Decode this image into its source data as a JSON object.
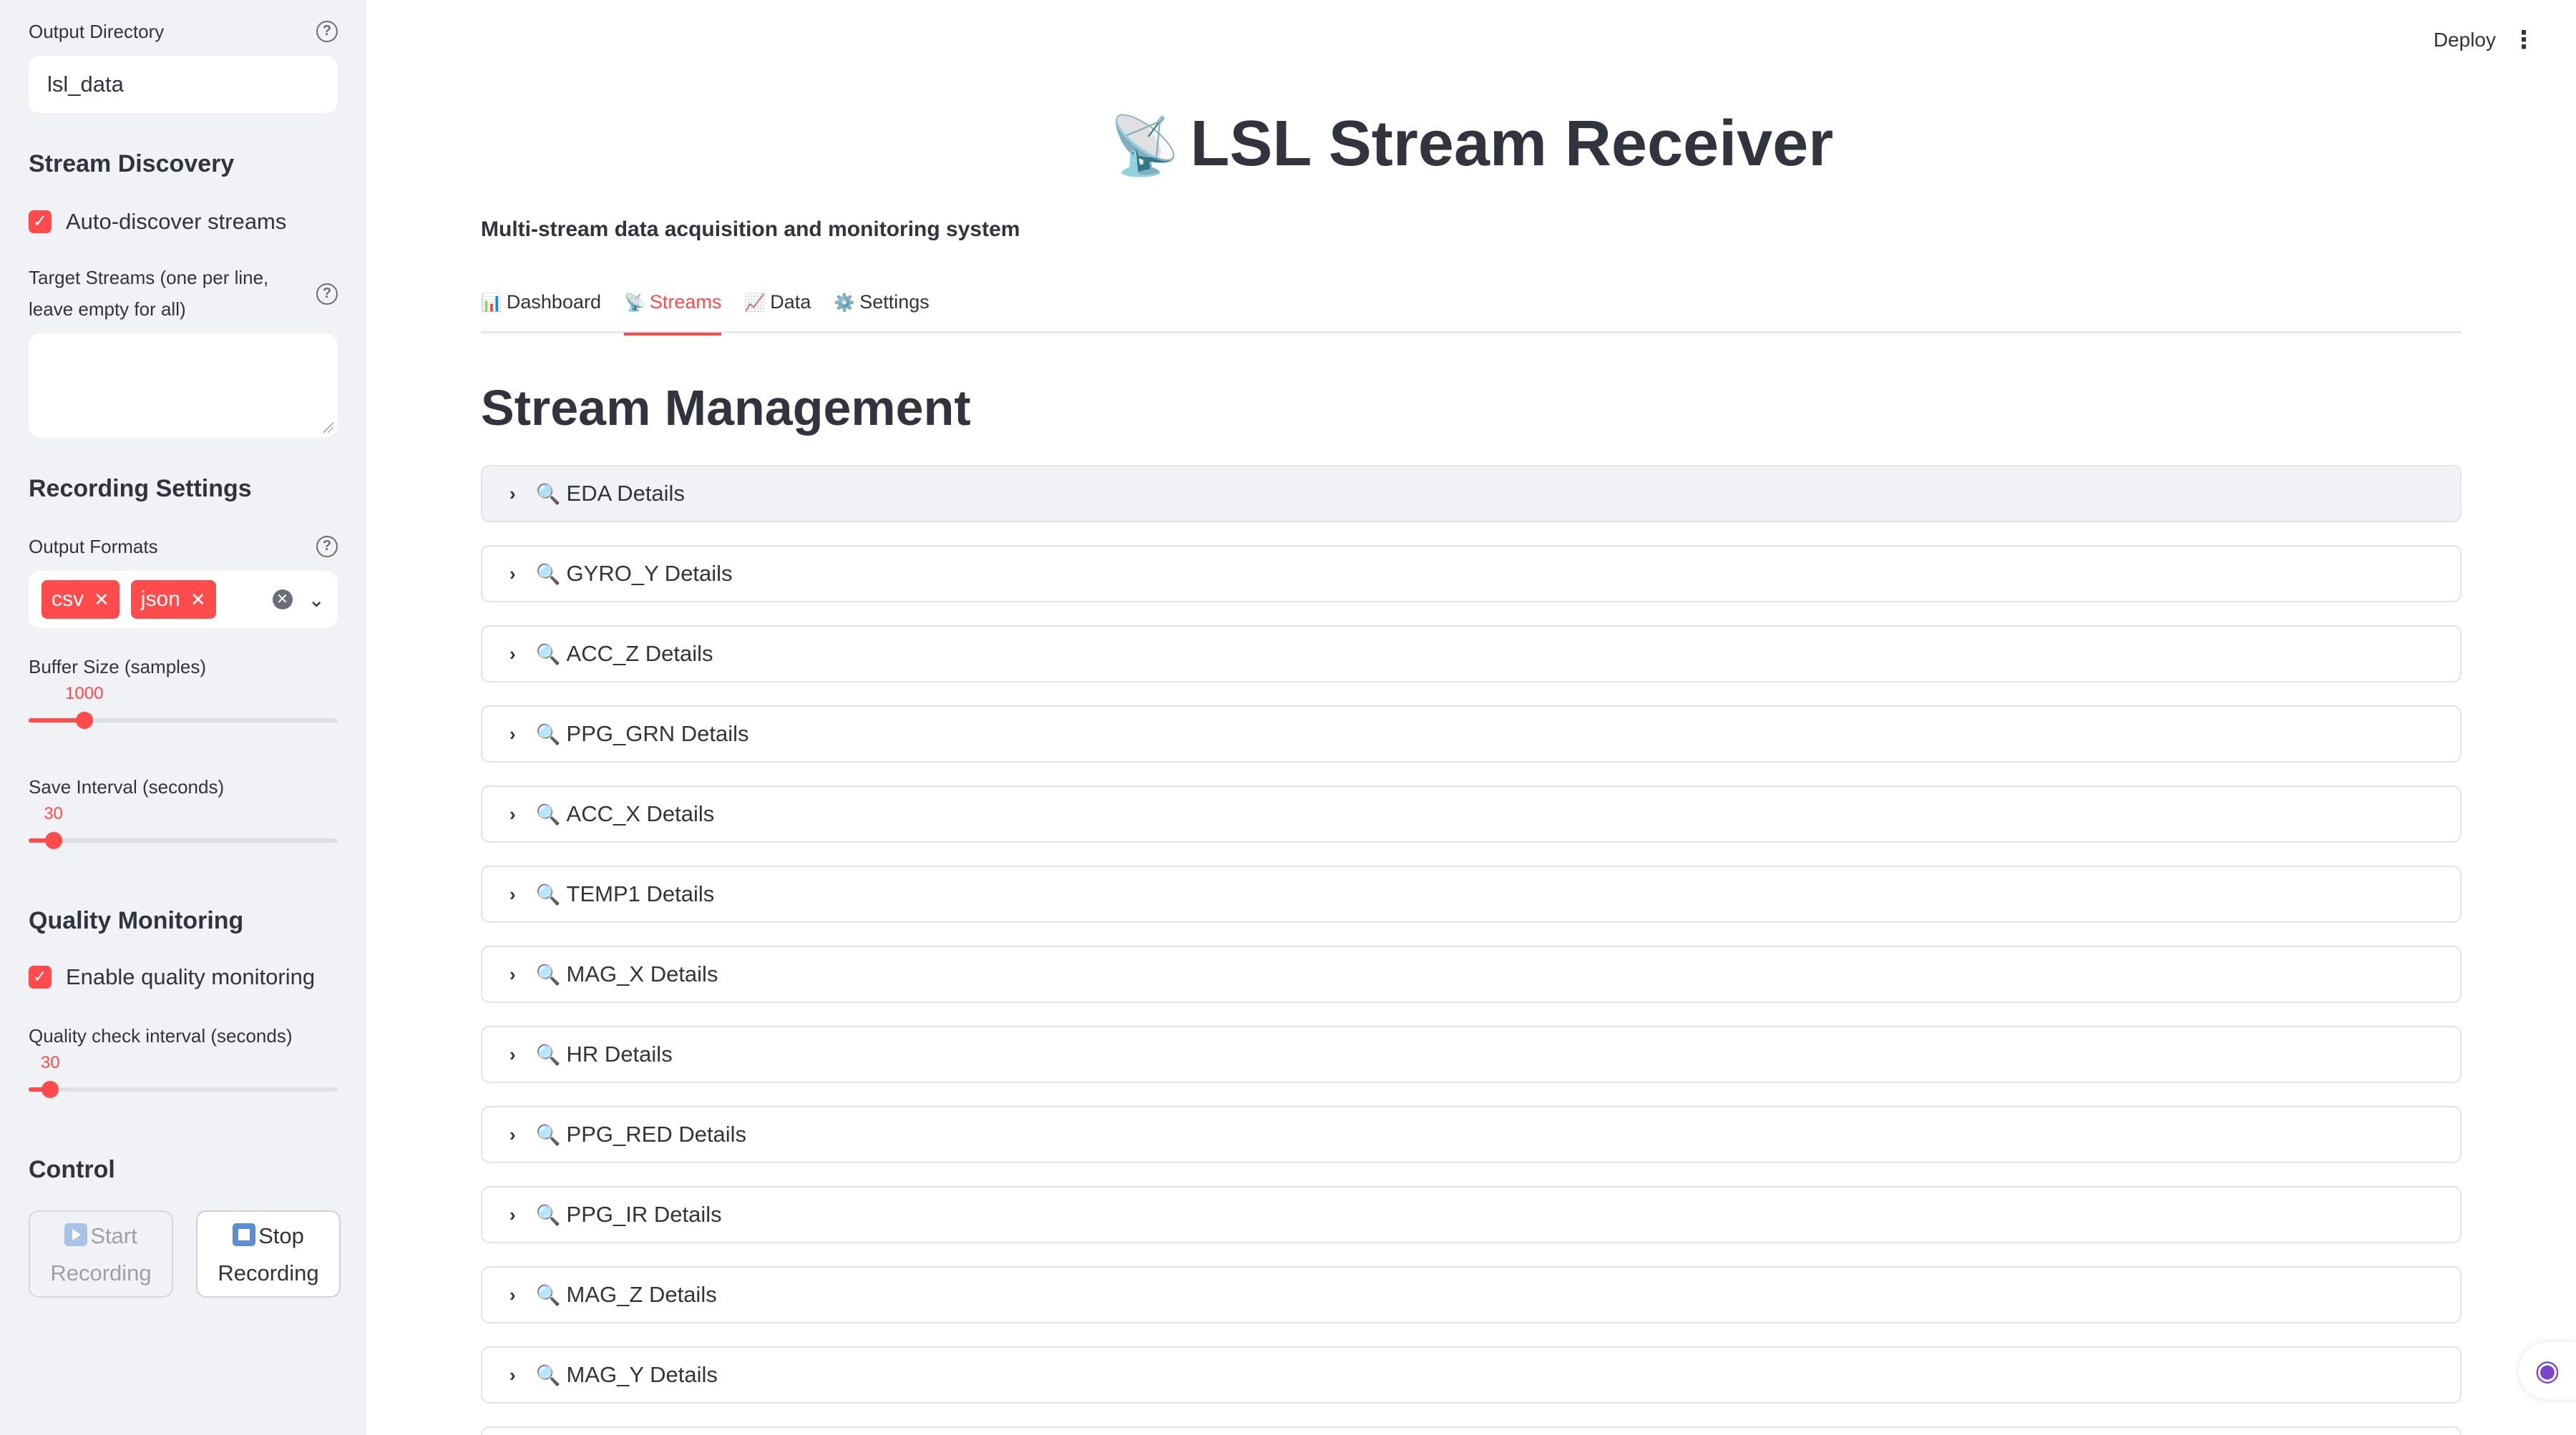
{
  "sidebar": {
    "output_directory": {
      "label": "Output Directory",
      "value": "lsl_data"
    },
    "stream_discovery": {
      "title": "Stream Discovery",
      "auto_discover_label": "Auto-discover streams",
      "auto_discover_checked": true,
      "target_label_line1": "Target Streams (one per line,",
      "target_label_line2": "leave empty for all)",
      "target_value": ""
    },
    "recording_settings": {
      "title": "Recording Settings",
      "output_formats_label": "Output Formats",
      "formats": [
        "csv",
        "json"
      ],
      "buffer_size": {
        "label": "Buffer Size (samples)",
        "value": "1000",
        "fraction": 0.18
      },
      "save_interval": {
        "label": "Save Interval (seconds)",
        "value": "30",
        "fraction": 0.08
      }
    },
    "quality_monitoring": {
      "title": "Quality Monitoring",
      "enable_label": "Enable quality monitoring",
      "enable_checked": true,
      "interval": {
        "label": "Quality check interval (seconds)",
        "value": "30",
        "fraction": 0.07
      }
    },
    "control": {
      "title": "Control",
      "start_line1": "Start",
      "start_line2": "Recording",
      "stop_line1": "Stop",
      "stop_line2": "Recording"
    }
  },
  "header": {
    "deploy_label": "Deploy",
    "menu_icon": "kebab-menu-icon",
    "title": "LSL Stream Receiver",
    "title_emoji": "📡",
    "subtitle": "Multi-stream data acquisition and monitoring system"
  },
  "tabs": [
    {
      "icon": "📊",
      "label": "Dashboard",
      "active": false
    },
    {
      "icon": "📡",
      "label": "Streams",
      "active": true
    },
    {
      "icon": "📈",
      "label": "Data",
      "active": false
    },
    {
      "icon": "⚙️",
      "label": "Settings",
      "active": false
    }
  ],
  "main": {
    "section_title": "Stream Management",
    "expanders": [
      "EDA Details",
      "GYRO_Y Details",
      "ACC_Z Details",
      "PPG_GRN Details",
      "ACC_X Details",
      "TEMP1 Details",
      "MAG_X Details",
      "HR Details",
      "PPG_RED Details",
      "PPG_IR Details",
      "MAG_Z Details",
      "MAG_Y Details"
    ]
  },
  "colors": {
    "accent": "#FF4B4B",
    "sidebar_bg": "#F0F2F6",
    "text": "#31333F"
  }
}
